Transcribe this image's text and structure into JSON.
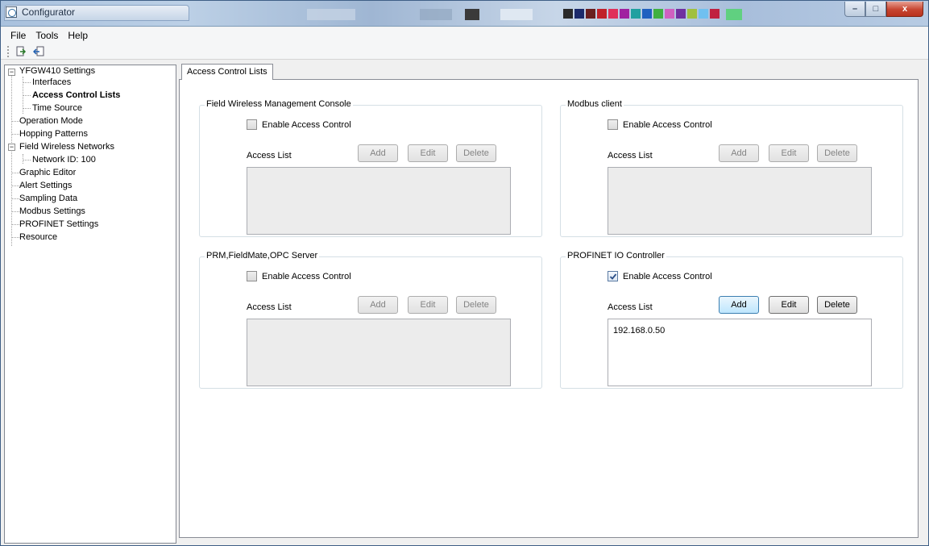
{
  "window": {
    "title": "Configurator",
    "controls": {
      "minimize": "–",
      "maximize": "□",
      "close": "x"
    }
  },
  "menu": [
    "File",
    "Tools",
    "Help"
  ],
  "toolbar": {
    "buttons": [
      "import-icon",
      "export-icon"
    ]
  },
  "tree": {
    "root": "YFGW410 Settings",
    "interfaces": "Interfaces",
    "acl": "Access Control Lists",
    "time_source": "Time Source",
    "operation_mode": "Operation Mode",
    "hopping_patterns": "Hopping Patterns",
    "fwn": "Field Wireless Networks",
    "network_id": "Network ID: 100",
    "graphic_editor": "Graphic Editor",
    "alert_settings": "Alert Settings",
    "sampling_data": "Sampling Data",
    "modbus_settings": "Modbus Settings",
    "profinet_settings": "PROFINET Settings",
    "resource": "Resource",
    "expander_open": "−"
  },
  "tab": {
    "label": "Access Control Lists"
  },
  "groups": {
    "fwmc": {
      "title": "Field Wireless Management Console",
      "enable_label": "Enable Access Control",
      "enabled": false,
      "access_list_label": "Access List",
      "add": "Add",
      "edit": "Edit",
      "delete": "Delete",
      "items": []
    },
    "modbus": {
      "title": "Modbus client",
      "enable_label": "Enable Access Control",
      "enabled": false,
      "access_list_label": "Access List",
      "add": "Add",
      "edit": "Edit",
      "delete": "Delete",
      "items": []
    },
    "prm": {
      "title": "PRM,FieldMate,OPC Server",
      "enable_label": "Enable Access Control",
      "enabled": false,
      "access_list_label": "Access List",
      "add": "Add",
      "edit": "Edit",
      "delete": "Delete",
      "items": []
    },
    "profinet": {
      "title": "PROFINET IO Controller",
      "enable_label": "Enable Access Control",
      "enabled": true,
      "access_list_label": "Access List",
      "add": "Add",
      "edit": "Edit",
      "delete": "Delete",
      "items": [
        "192.168.0.50"
      ]
    }
  },
  "colors": {
    "accent": "#3c7fb1",
    "disabled_text": "#838383",
    "list_disabled_bg": "#ececec"
  }
}
